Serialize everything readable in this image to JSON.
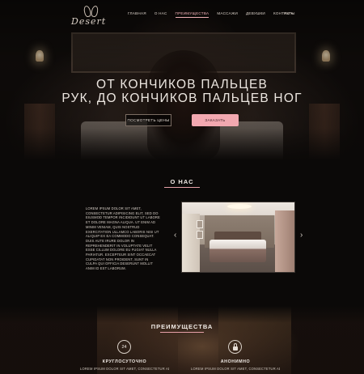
{
  "header": {
    "logo_text": "Desert",
    "nav": [
      "ГЛАВНАЯ",
      "О НАС",
      "ПРЕИМУЩЕСТВА",
      "МАССАЖИ",
      "ДЕВУШКИ",
      "КОНТАКТЫ"
    ],
    "active_nav": "ПРЕИМУЩЕСТВА",
    "language": "RU",
    "language_caret": "▾"
  },
  "hero": {
    "title_line1": "ОТ КОНЧИКОВ ПАЛЬЦЕВ",
    "title_line2": "РУК, ДО КОНЧИКОВ ПАЛЬЦЕВ НОГ",
    "button_prices": "ПОСМОТРЕТЬ ЦЕНЫ",
    "button_order": "ЗАКАЗАТЬ"
  },
  "about": {
    "title": "О НАС",
    "text": "LOREM IPSUM DOLOR SIT AMET, CONSECTETUR ADIPISICING ELIT, SED DO EIUSMOD TEMPOR INCIDIDUNT UT LABORE ET DOLORE MAGNA ALIQUA. UT ENIM AD MINIM VENIAM, QUIS NOSTRUD EXERCITATION ULLAMCO LABORIS NISI UT ALIQUIP EX EA COMMODO CONSEQUAT. DUIS AUTE IRURE DOLOR IN REPREHENDERIT IN VOLUPTATE VELIT ESSE CILLUM DOLORE EU FUGIAT NULLA PARIATUR. EXCEPTEUR SINT OCCAECAT CUPIDATAT NON PROIDENT, SUNT IN CULPA QUI OFFICIA DESERUNT MOLLIT ANIM ID EST LABORUM.",
    "slider_prev": "‹",
    "slider_next": "›"
  },
  "advantages": {
    "title": "ПРЕИМУЩЕСТВА",
    "items": [
      {
        "icon": "24",
        "icon_name": "clock-24-icon",
        "name": "КРУГЛОСУТОЧНО",
        "desc": "LOREM IPSUM DOLOR SIT AMET, CONSECTETUR ADIPISICING"
      },
      {
        "icon": "",
        "icon_name": "lock-icon",
        "name": "АНОНИМНО",
        "desc": "LOREM IPSUM DOLOR SIT AMET, CONSECTETUR ADIPISICING"
      }
    ]
  },
  "colors": {
    "accent": "#f2a8b0",
    "background": "#0b0908",
    "text": "#ece6e0"
  }
}
